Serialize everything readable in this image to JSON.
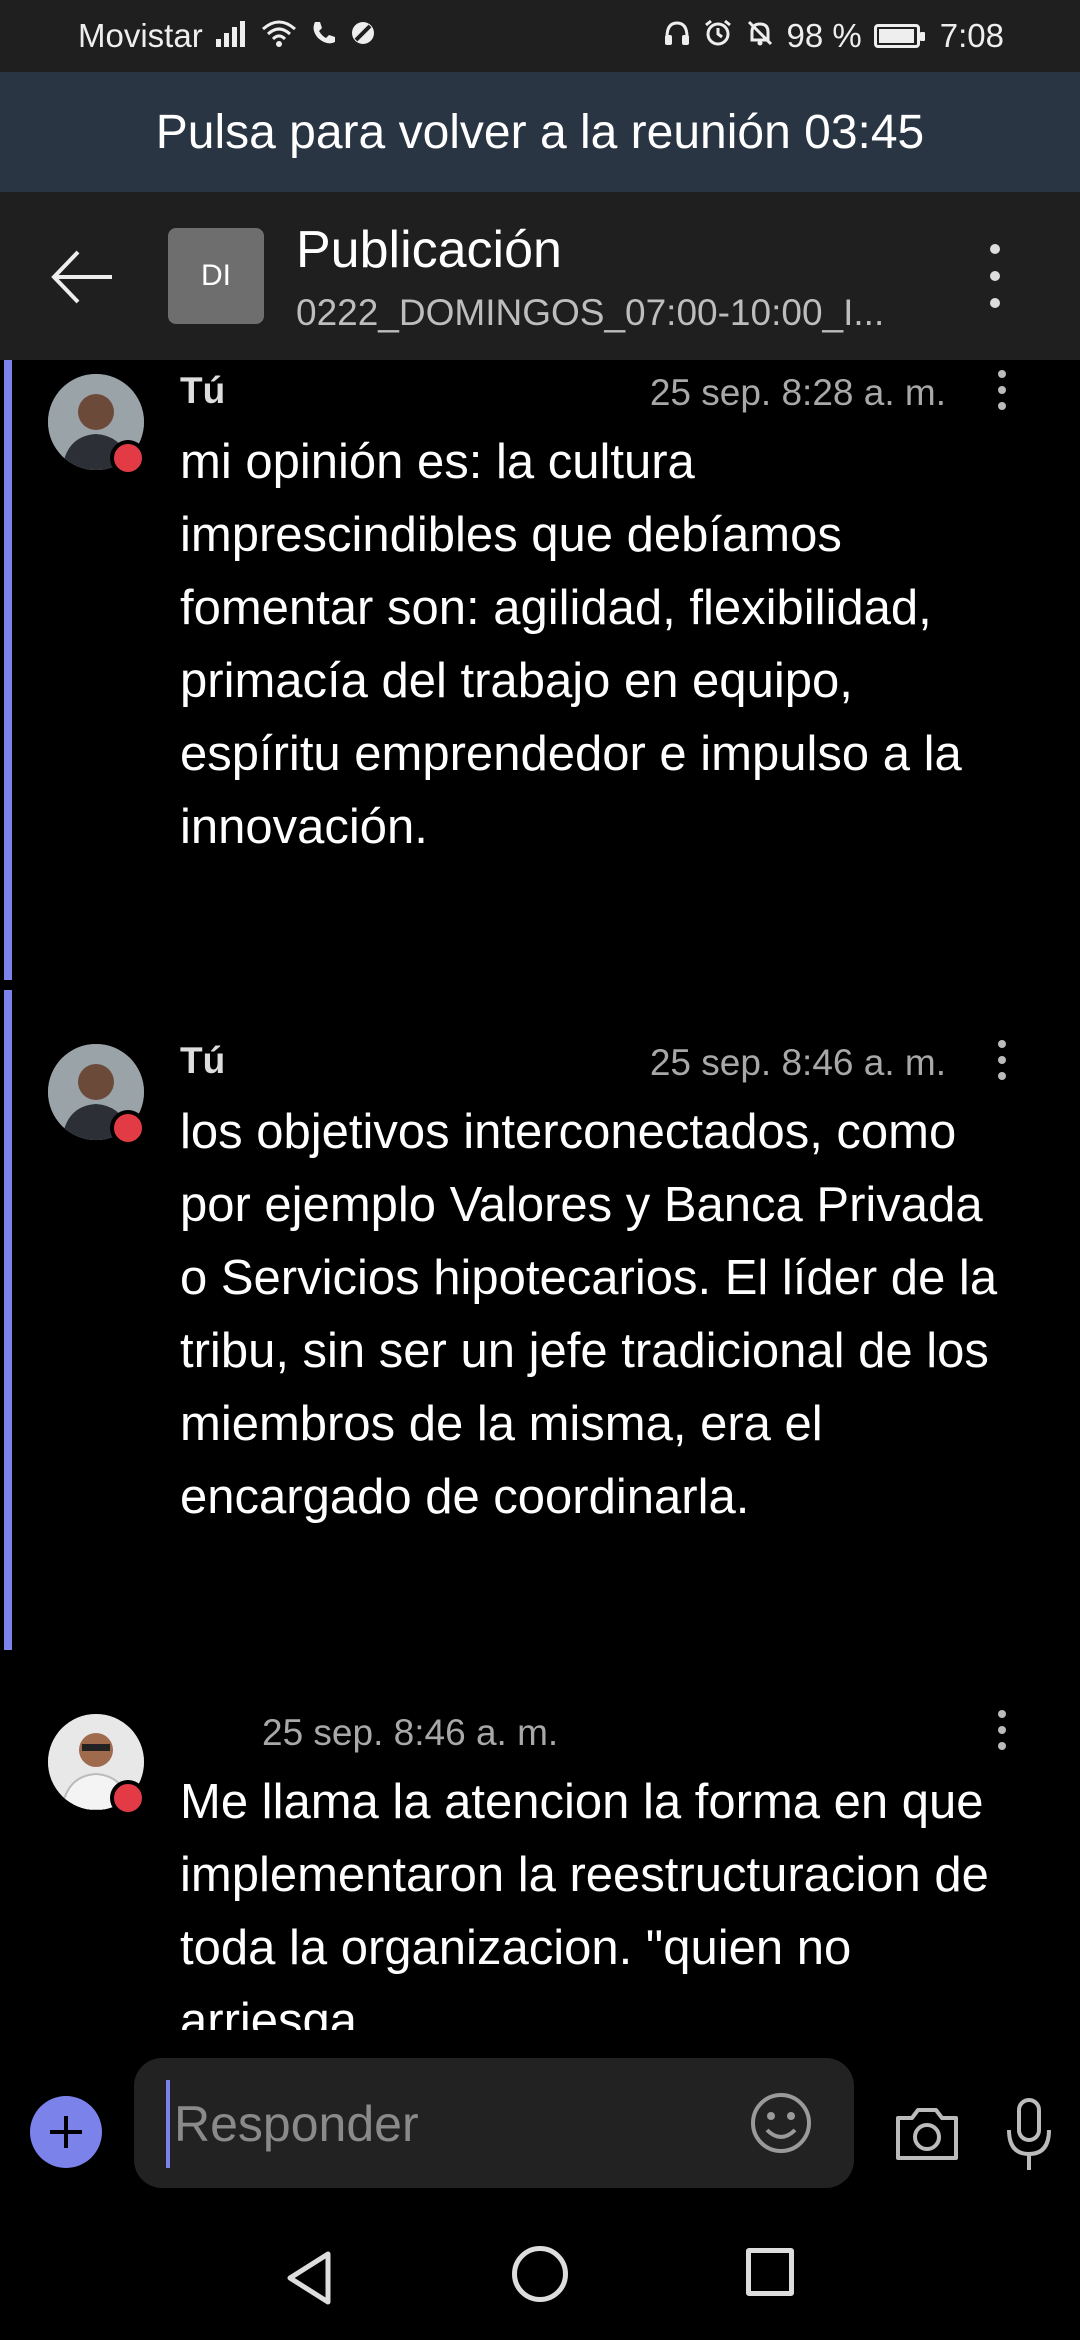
{
  "status_bar": {
    "carrier": "Movistar",
    "battery": "98 %",
    "battery_level": 0.98,
    "time": "7:08",
    "icons_left": [
      "signal-icon",
      "wifi-icon",
      "phone-icon",
      "blocked-icon"
    ],
    "icons_right": [
      "headphones-icon",
      "alarm-icon",
      "mute-notifications-icon",
      "battery-icon"
    ]
  },
  "meeting_banner": {
    "text": "Pulsa para volver a la reunión 03:45"
  },
  "header": {
    "avatar_initials": "DI",
    "title": "Publicación",
    "subtitle": "0222_DOMINGOS_07:00-10:00_I..."
  },
  "messages": [
    {
      "author": "Tú",
      "time": "25 sep. 8:28 a. m.",
      "text": "mi opinión es: la cultura imprescindibles que debíamos fomentar son: agilidad, flexibilidad, primacía del trabajo en equipo, espíritu emprendedor e impulso a la innovación."
    },
    {
      "author": "Tú",
      "time": "25 sep. 8:46 a. m.",
      "text": "los objetivos interconectados, como por ejemplo Valores y Banca Privada o Servicios hipotecarios. El líder de la tribu, sin ser un jefe tradicional de los miembros de la misma, era el encargado de coordinarla."
    },
    {
      "author": "",
      "time": "25 sep. 8:46 a. m.",
      "text": "Me llama la atencion la forma en que implementaron la reestructuracion de toda la organizacion. \"quien no arriesga"
    }
  ],
  "compose": {
    "placeholder": "Responder"
  },
  "colors": {
    "accent": "#7b83eb",
    "presence_busy": "#e23b45",
    "banner_bg": "#2a3543"
  }
}
